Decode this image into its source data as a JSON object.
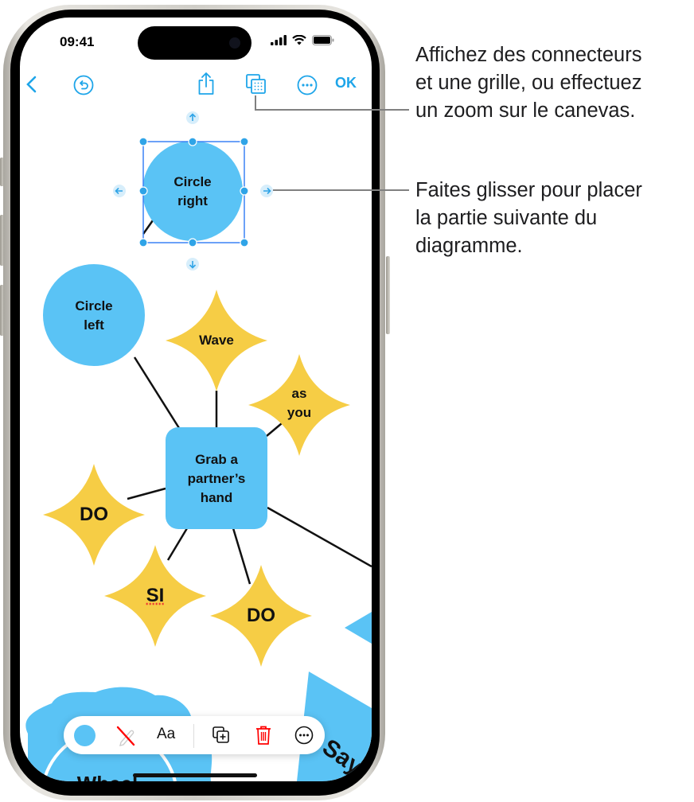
{
  "status_bar": {
    "time": "09:41",
    "icons": [
      "cellular-signal-icon",
      "wifi-icon",
      "battery-icon"
    ]
  },
  "toolbar": {
    "back_icon": "chevron-left-icon",
    "undo_icon": "undo-circle-icon",
    "share_icon": "share-icon",
    "view_options_icon": "connectors-grid-icon",
    "more_icon": "ellipsis-circle-icon",
    "ok_label": "OK",
    "accent_color": "#1EA5E9"
  },
  "diagram": {
    "shape_blue": "#5AC3F5",
    "shape_yellow": "#F6CD45",
    "selection_color": "#3B82F6",
    "nodes": [
      {
        "id": "circle-right",
        "shape": "circle",
        "label_lines": [
          "Circle",
          "right"
        ],
        "selected": true
      },
      {
        "id": "circle-left",
        "shape": "circle",
        "label_lines": [
          "Circle",
          "left"
        ]
      },
      {
        "id": "wave",
        "shape": "star",
        "label_lines": [
          "Wave"
        ]
      },
      {
        "id": "as-you",
        "shape": "star",
        "label_lines": [
          "as",
          "you"
        ]
      },
      {
        "id": "grab",
        "shape": "rounded-square",
        "label_lines": [
          "Grab a",
          "partner’s",
          "hand"
        ]
      },
      {
        "id": "do-left",
        "shape": "star",
        "label_lines": [
          "DO"
        ]
      },
      {
        "id": "si",
        "shape": "star",
        "label_lines": [
          "SI"
        ]
      },
      {
        "id": "do-bottom",
        "shape": "star",
        "label_lines": [
          "DO"
        ]
      },
      {
        "id": "wheel",
        "shape": "cloud",
        "label_lines": [
          "Wheel"
        ]
      },
      {
        "id": "say",
        "shape": "triangle",
        "label_lines": [
          "Say"
        ]
      }
    ]
  },
  "context_toolbar": {
    "items": [
      {
        "name": "fill-color-button",
        "icon": "color-swatch-icon"
      },
      {
        "name": "stroke-button",
        "icon": "no-stroke-icon"
      },
      {
        "name": "text-style-button",
        "label": "Aa"
      },
      {
        "name": "duplicate-button",
        "icon": "duplicate-icon"
      },
      {
        "name": "delete-button",
        "icon": "trash-icon"
      },
      {
        "name": "more-button",
        "icon": "ellipsis-circle-icon"
      }
    ]
  },
  "callouts": {
    "top": [
      "Affichez des connecteurs",
      "et une grille, ou effectuez",
      "un zoom sur le canevas."
    ],
    "middle": [
      "Faites glisser pour placer",
      "la partie suivante du",
      "diagramme."
    ]
  }
}
